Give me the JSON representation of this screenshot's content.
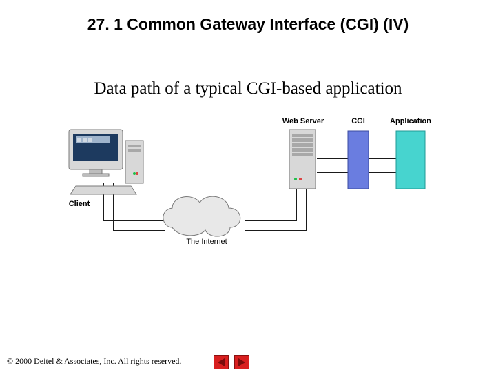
{
  "title": "27. 1 Common Gateway Interface (CGI) (IV)",
  "subtitle": "Data path of a typical CGI-based application",
  "diagram": {
    "labels": {
      "client": "Client",
      "web_server": "Web Server",
      "cgi": "CGI",
      "application": "Application",
      "internet": "The Internet"
    }
  },
  "footer": "© 2000 Deitel & Associates, Inc. All rights reserved.",
  "nav": {
    "prev": "Previous",
    "next": "Next"
  }
}
